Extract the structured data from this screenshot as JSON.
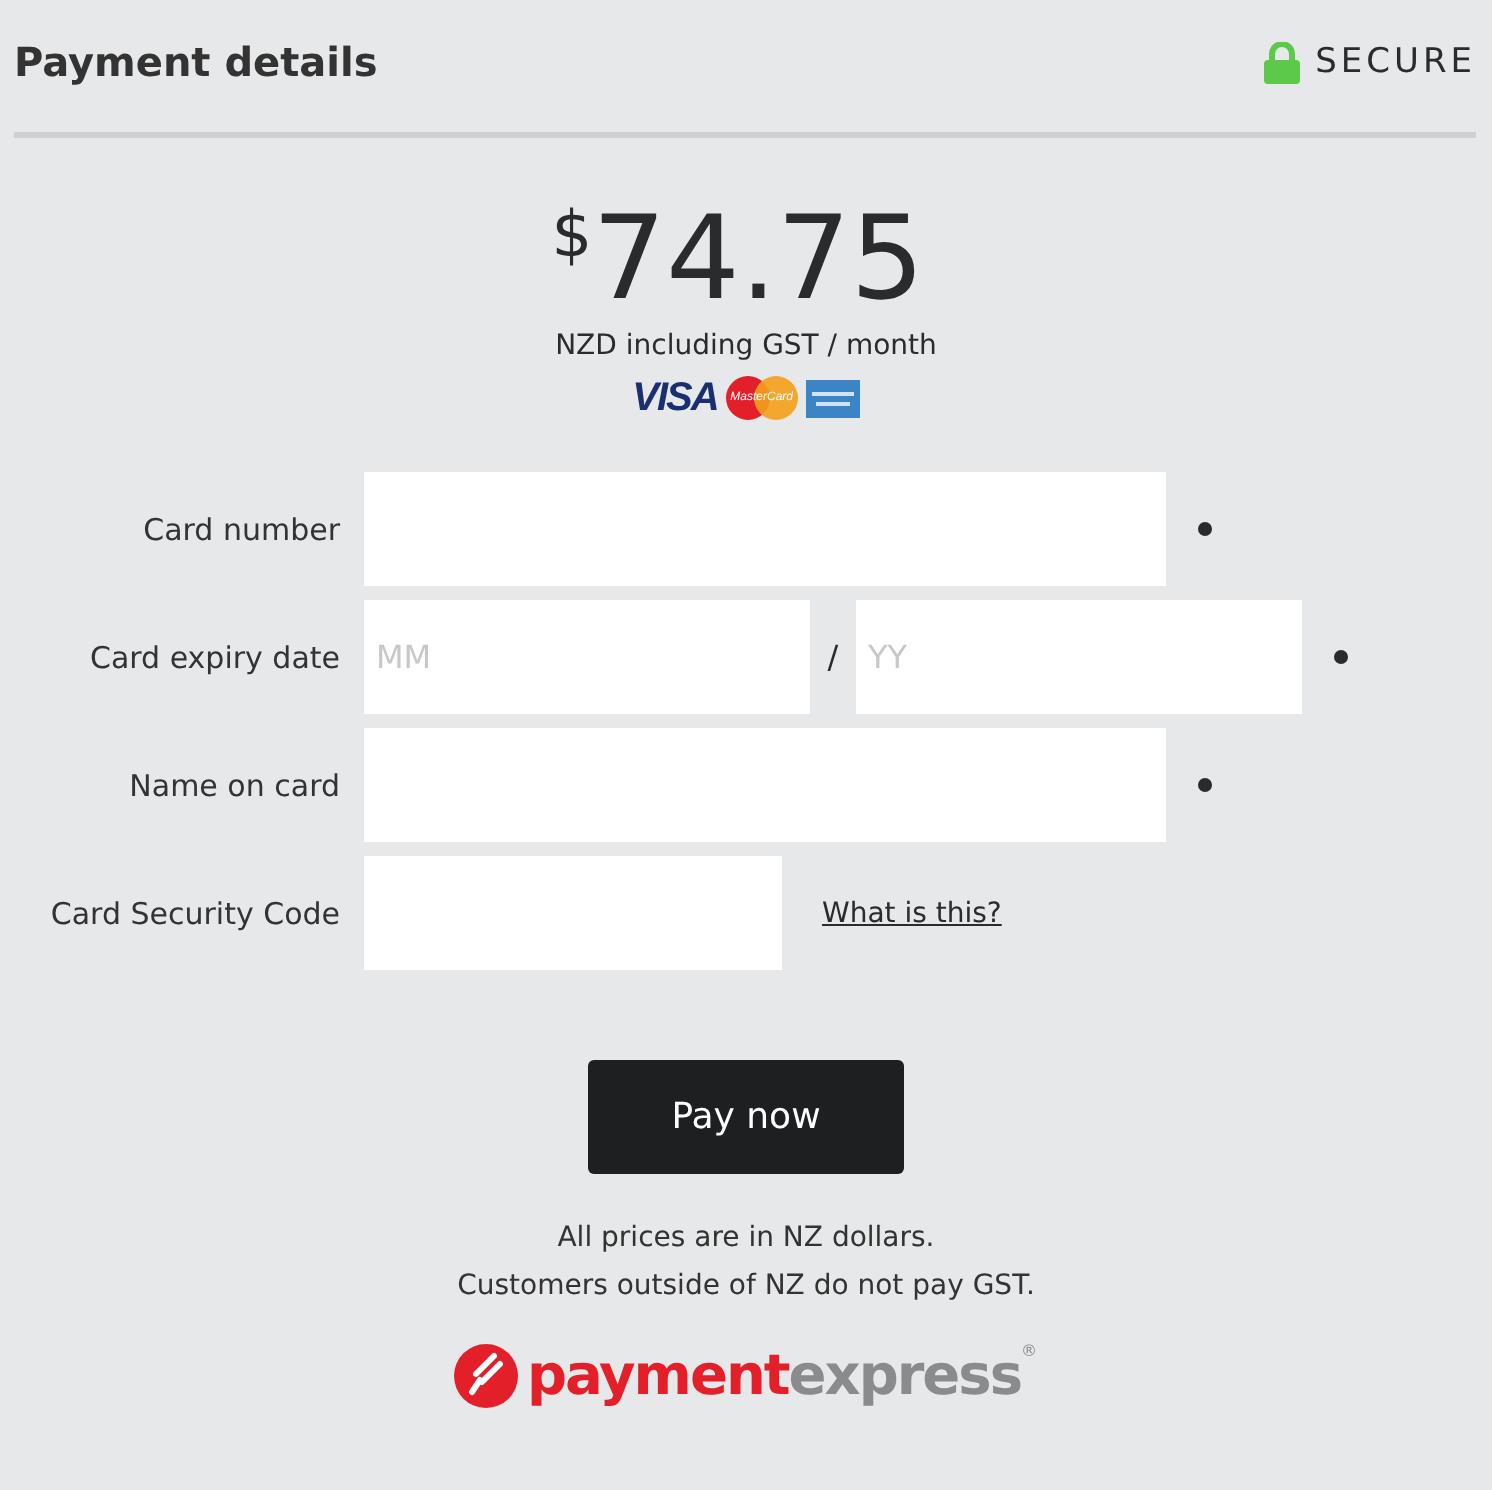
{
  "header": {
    "title": "Payment details",
    "secure": "SECURE"
  },
  "price": {
    "currency": "$",
    "amount": "74.75",
    "note": "NZD including GST / month"
  },
  "card_logos": [
    {
      "kind": "visa",
      "text": "VISA"
    },
    {
      "kind": "mastercard",
      "text": "MasterCard"
    },
    {
      "kind": "amex"
    }
  ],
  "fields": [
    {
      "kind": "text",
      "label": "Card number",
      "required": true
    },
    {
      "kind": "expiry",
      "label": "Card expiry date",
      "placeholder_1": "MM",
      "separator": "/",
      "placeholder_2": "YY",
      "required": true
    },
    {
      "kind": "text",
      "label": "Name on card",
      "required": true
    },
    {
      "kind": "short",
      "label": "Card Security Code",
      "required": false,
      "link": "What is this?"
    }
  ],
  "button": "Pay now",
  "notes": [
    "All prices are in NZ dollars.",
    "Customers outside of NZ do not pay GST."
  ],
  "brand": {
    "part_1": "payment",
    "part_2": "express",
    "mark": "®"
  }
}
